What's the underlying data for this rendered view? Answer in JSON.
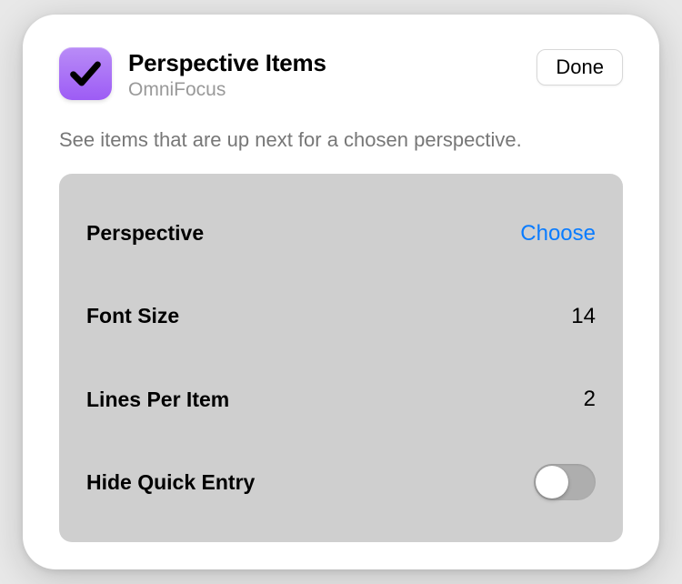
{
  "header": {
    "title": "Perspective Items",
    "subtitle": "OmniFocus",
    "done_label": "Done"
  },
  "description": "See items that are up next for a chosen perspective.",
  "settings": {
    "perspective": {
      "label": "Perspective",
      "action": "Choose"
    },
    "font_size": {
      "label": "Font Size",
      "value": "14"
    },
    "lines_per_item": {
      "label": "Lines Per Item",
      "value": "2"
    },
    "hide_quick_entry": {
      "label": "Hide Quick Entry",
      "value": false
    }
  },
  "icon": {
    "name": "checkmark"
  },
  "colors": {
    "accent": "#0a7cff",
    "icon_bg_top": "#b98cf7",
    "icon_bg_bottom": "#9d5cf5"
  }
}
